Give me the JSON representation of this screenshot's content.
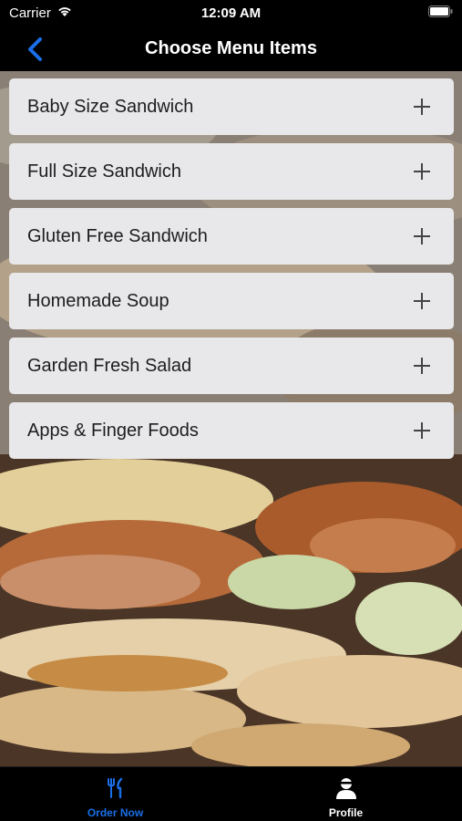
{
  "status": {
    "carrier": "Carrier",
    "time": "12:09 AM"
  },
  "nav": {
    "title": "Choose Menu Items",
    "back_icon": "chevron-left-icon"
  },
  "menu": {
    "items": [
      {
        "label": "Baby Size Sandwich",
        "icon": "plus-icon"
      },
      {
        "label": "Full Size Sandwich",
        "icon": "plus-icon"
      },
      {
        "label": "Gluten Free Sandwich",
        "icon": "plus-icon"
      },
      {
        "label": "Homemade Soup",
        "icon": "plus-icon"
      },
      {
        "label": "Garden Fresh Salad",
        "icon": "plus-icon"
      },
      {
        "label": "Apps & Finger Foods",
        "icon": "plus-icon"
      }
    ]
  },
  "tabs": {
    "order": {
      "label": "Order Now",
      "icon": "fork-knife-icon",
      "active": true
    },
    "profile": {
      "label": "Profile",
      "icon": "person-icon",
      "active": false
    }
  },
  "colors": {
    "accent": "#1a6fe8",
    "card_bg": "#e8e8ea",
    "bar_bg": "#000000",
    "text_dark": "#1d1d1f"
  }
}
